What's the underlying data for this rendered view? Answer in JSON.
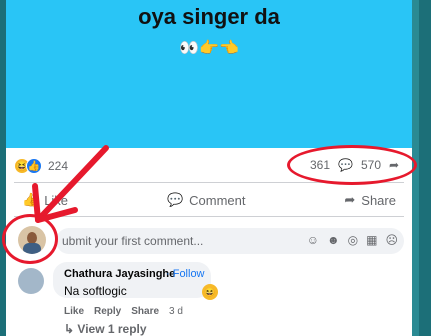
{
  "post": {
    "text": "oya singer da",
    "emoji": "👀👉👈",
    "background_color": "#29c5f6"
  },
  "reactions": {
    "count": "224",
    "comments": "361",
    "shares": "570"
  },
  "actions": {
    "like": "Like",
    "comment": "Comment",
    "share": "Share"
  },
  "composer": {
    "placeholder": "ubmit your first comment..."
  },
  "comment": {
    "author": "Chathura Jayasinghe",
    "follow": "· Follow",
    "text": "Na softlogic",
    "like": "Like",
    "reply": "Reply",
    "share": "Share",
    "time": "3 d",
    "view_replies": "View 1 reply"
  },
  "annotation_color": "#e6192d"
}
